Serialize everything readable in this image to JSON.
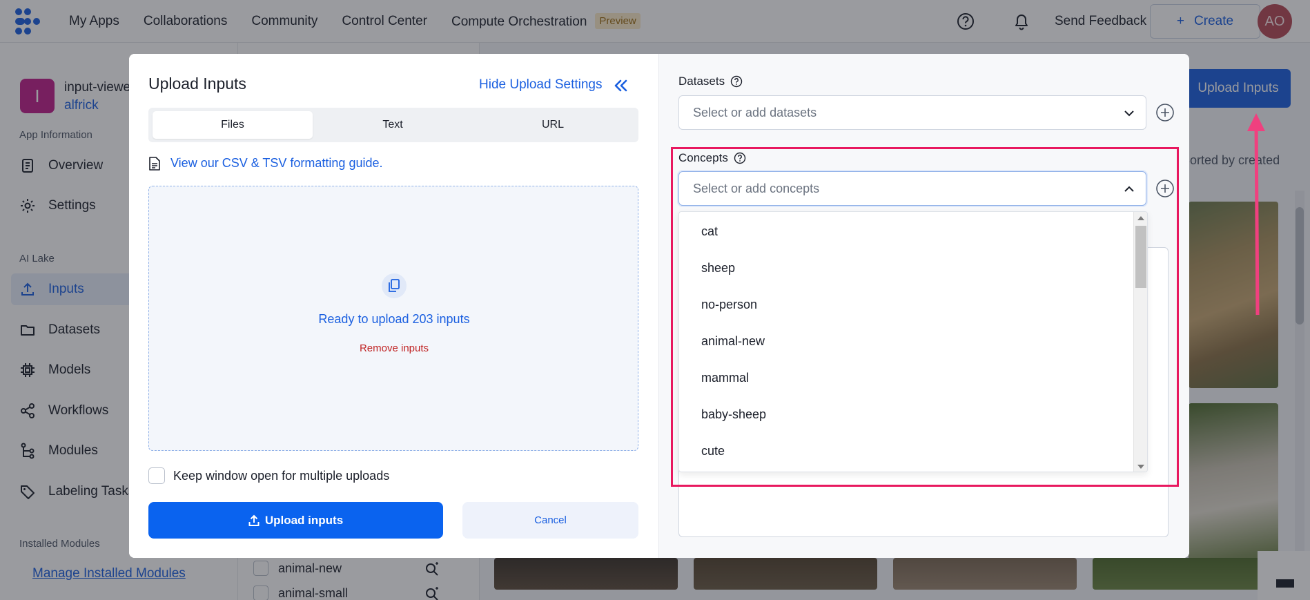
{
  "nav": {
    "items": [
      "My Apps",
      "Collaborations",
      "Community",
      "Control Center",
      "Compute Orchestration"
    ],
    "preview_badge": "Preview",
    "send_feedback": "Send Feedback",
    "create_label": "Create",
    "user_initials": "AO"
  },
  "sidebar": {
    "app_initial": "I",
    "app_name": "input-viewer",
    "app_owner": "alfrick",
    "section_app_info": "App Information",
    "overview": "Overview",
    "settings": "Settings",
    "section_ai_lake": "AI Lake",
    "inputs": "Inputs",
    "datasets": "Datasets",
    "models": "Models",
    "workflows": "Workflows",
    "modules": "Modules",
    "labeling_tasks": "Labeling Tasks",
    "section_installed": "Installed Modules",
    "manage_modules": "Manage Installed Modules"
  },
  "background": {
    "upload_inputs": "Upload Inputs",
    "sorted_by": "Sorted by created",
    "concept_rows": [
      "animal-new",
      "animal-small"
    ]
  },
  "modal": {
    "title": "Upload Inputs",
    "hide_settings": "Hide Upload Settings",
    "tabs": [
      "Files",
      "Text",
      "URL"
    ],
    "csv_guide": "View our CSV & TSV formatting guide.",
    "ready_text": "Ready to upload 203 inputs",
    "remove_text": "Remove inputs",
    "keep_open": "Keep window open for multiple uploads",
    "upload_button": "Upload inputs",
    "cancel_button": "Cancel",
    "datasets_label": "Datasets",
    "datasets_placeholder": "Select or add datasets",
    "concepts_label": "Concepts",
    "concepts_placeholder": "Select or add concepts",
    "concept_options": [
      "cat",
      "sheep",
      "no-person",
      "animal-new",
      "mammal",
      "baby-sheep",
      "cute"
    ]
  },
  "colors": {
    "accent": "#1a5fe0",
    "primary_button": "#0a63ef",
    "highlight": "#e8185f",
    "danger": "#c02424"
  }
}
